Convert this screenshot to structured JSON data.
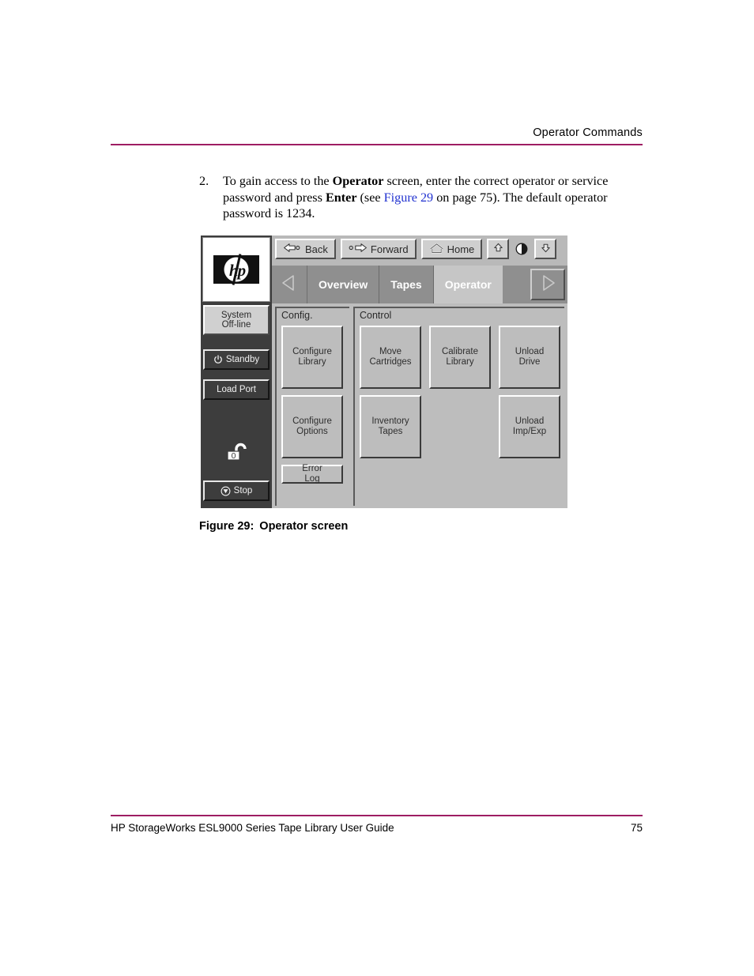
{
  "page": {
    "header_title": "Operator Commands",
    "footer_title": "HP StorageWorks ESL9000 Series Tape Library User Guide",
    "footer_page_number": "75",
    "rule_color": "#9e1d63"
  },
  "step": {
    "number": "2.",
    "text_1": "To gain access to the ",
    "bold_1": "Operator",
    "text_2": " screen, enter the correct operator or service password and press ",
    "bold_2": "Enter",
    "text_3": " (see ",
    "xref": "Figure 29",
    "text_4": " on page 75). The default operator password is 1234."
  },
  "figure": {
    "label": "Figure 29:",
    "title": "Operator screen"
  },
  "library_ui": {
    "logo": {
      "name": "hp-logo",
      "wordmark": "hp"
    },
    "sidebar": {
      "status_button": {
        "line1": "System",
        "line2": "Off-line",
        "icon": "none"
      },
      "standby_button": {
        "label": "Standby",
        "icon": "power-icon"
      },
      "load_port_button": {
        "label": "Load Port",
        "icon": "none"
      },
      "lock_indicator": {
        "icon": "unlocked-padlock-icon",
        "state": "unlocked"
      },
      "stop_button": {
        "label": "Stop",
        "icon": "stop-icon"
      }
    },
    "toolbar": {
      "back_label": "Back",
      "back_icon": "arrow-left-icon",
      "forward_label": "Forward",
      "forward_icon": "arrow-right-icon",
      "home_label": "Home",
      "home_icon": "home-icon",
      "brightness_up_icon": "arrow-up-icon",
      "contrast_icon": "contrast-icon",
      "brightness_down_icon": "arrow-down-icon"
    },
    "tabs": {
      "prev_icon": "triangle-left-icon",
      "next_icon": "triangle-right-icon",
      "items": [
        {
          "label": "Overview",
          "active": false
        },
        {
          "label": "Tapes",
          "active": false
        },
        {
          "label": "Operator",
          "active": true
        }
      ]
    },
    "panels": [
      {
        "title": "Config.",
        "buttons": [
          {
            "line1": "Configure",
            "line2": "Library",
            "size": "big"
          },
          {
            "line1": "Configure",
            "line2": "Options",
            "size": "big"
          },
          {
            "line1": "Error",
            "line2": "Log",
            "size": "small"
          }
        ]
      },
      {
        "title": "Control",
        "buttons": [
          {
            "line1": "Move",
            "line2": "Cartridges",
            "size": "big"
          },
          {
            "line1": "Calibrate",
            "line2": "Library",
            "size": "big"
          },
          {
            "line1": "Unload",
            "line2": "Drive",
            "size": "big"
          },
          {
            "line1": "Inventory",
            "line2": "Tapes",
            "size": "big"
          },
          {
            "line1": "",
            "line2": "",
            "size": "spacer"
          },
          {
            "line1": "Unload",
            "line2": "Imp/Exp",
            "size": "big"
          }
        ]
      }
    ]
  }
}
